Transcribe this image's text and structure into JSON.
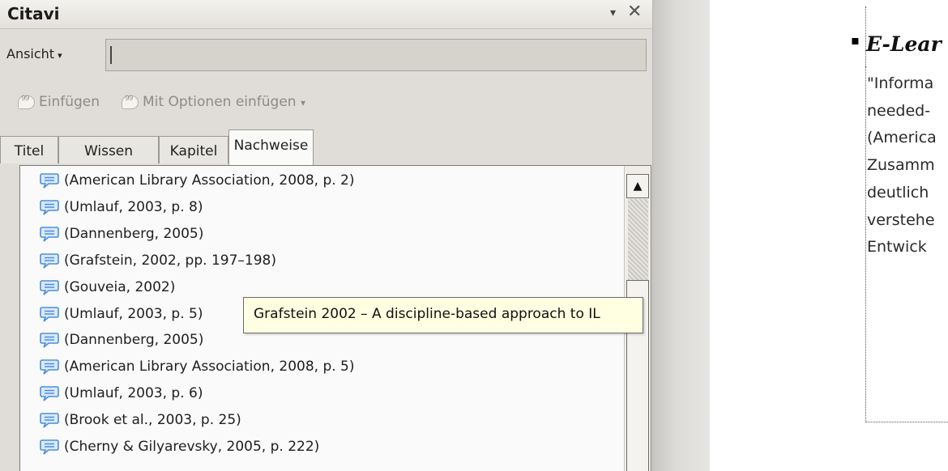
{
  "pane": {
    "title": "Citavi",
    "menu_arrow": "▾",
    "close": "✕",
    "view_label": "Ansicht",
    "view_arrow": "▾",
    "search_value": "",
    "insert_label": "Einfügen",
    "insert_options_label": "Mit Optionen einfügen",
    "insert_options_arrow": "▾"
  },
  "tabs": [
    {
      "label": "Titel",
      "active": false
    },
    {
      "label": "Wissen",
      "active": false
    },
    {
      "label": "Kapitel",
      "active": false
    },
    {
      "label": "Nachweise",
      "active": true
    }
  ],
  "citations": [
    "(American Library Association, 2008, p. 2)",
    "(Umlauf, 2003, p. 8)",
    "(Dannenberg, 2005)",
    "(Grafstein, 2002, pp. 197–198)",
    "(Gouveia, 2002)",
    "(Umlauf, 2003, p. 5)",
    "(Dannenberg, 2005)",
    "(American Library Association, 2008, p. 5)",
    "(Umlauf, 2003, p. 6)",
    "(Brook et al., 2003, p. 25)",
    "(Cherny & Gilyarevsky, 2005, p. 222)"
  ],
  "tooltip": "Grafstein 2002 – A discipline-based approach to IL",
  "scrollbar": {
    "up_arrow": "▲"
  },
  "document": {
    "bullet": "▪",
    "heading": "E-Lear",
    "lines": [
      "\"Informa",
      "needed-",
      "(America",
      "Zusamm",
      "deutlich",
      "verstehe",
      "Entwick"
    ]
  },
  "colors": {
    "bubble": "#4a8fe0",
    "tooltip_bg": "#ffffe1",
    "pane_bg": "#e0ddd8"
  }
}
